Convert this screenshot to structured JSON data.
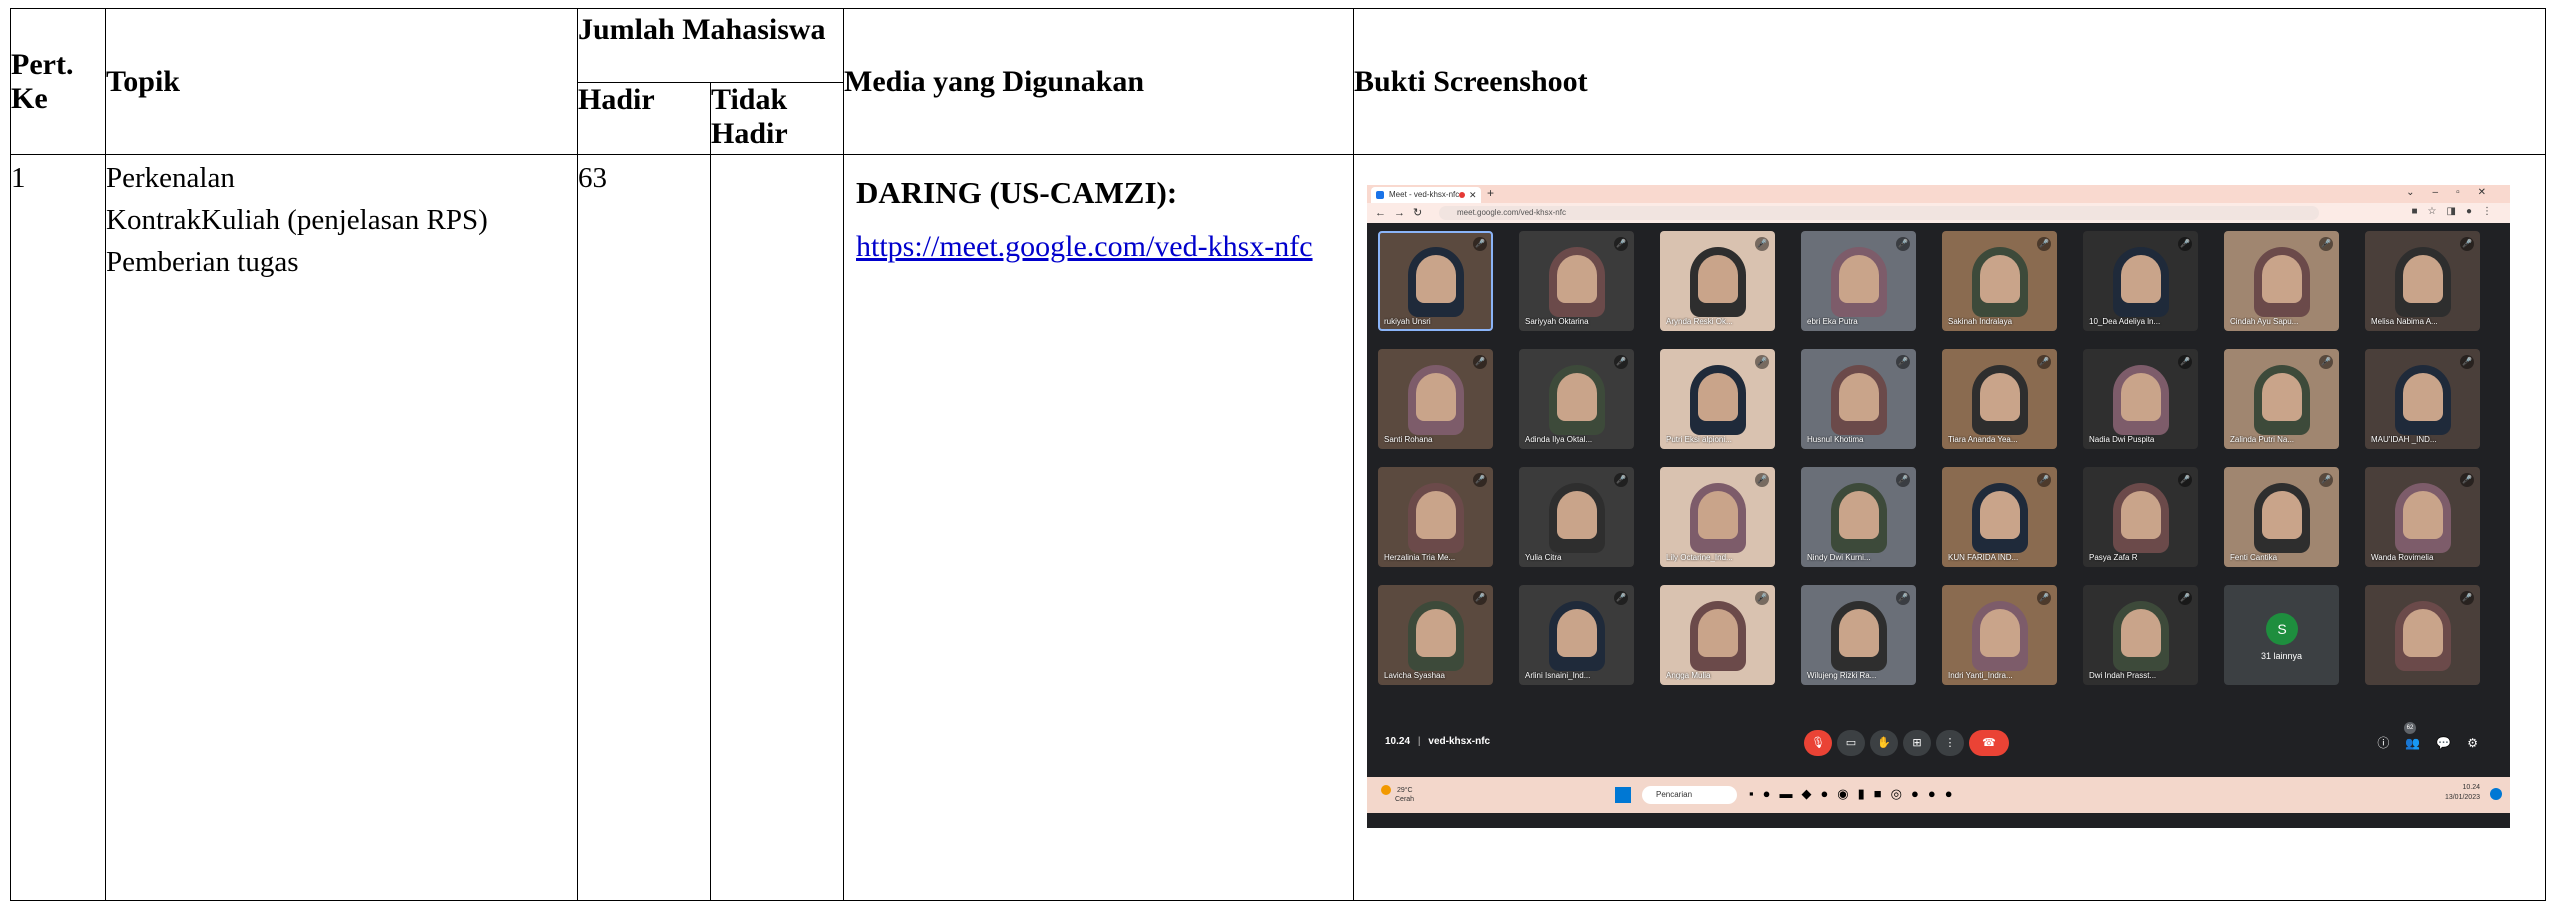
{
  "table": {
    "headers": {
      "pert_ke": "Pert. Ke",
      "topik": "Topik",
      "jumlah_mahasiswa": "Jumlah Mahasiswa",
      "hadir": "Hadir",
      "tidak_hadir": "Tidak Hadir",
      "media": "Media yang Digunakan",
      "bukti": "Bukti Screenshoot"
    },
    "row": {
      "pert_ke": "1",
      "topik_lines": [
        "Perkenalan",
        "KontrakKuliah (penjelasan RPS)",
        "Pemberian tugas"
      ],
      "hadir": "63",
      "tidak_hadir": "",
      "media_title": "DARING (US-CAMZI):",
      "media_link": "https://meet.google.com/ved-khsx-nfc"
    }
  },
  "screenshot": {
    "tab_title": "Meet - ved-khsx-nfc",
    "url": "meet.google.com/ved-khsx-nfc",
    "meeting_time": "10.24",
    "meeting_code": "ved-khsx-nfc",
    "participant_count_badge": "62",
    "participants": [
      "rukiyah Unsri",
      "Sariyyah Oktarina",
      "Arynda Reski Ok...",
      "ebri Eka Putra",
      "Sakinah Indralaya",
      "10_Dea Adeliya ln...",
      "Cindah Ayu Sapu...",
      "Melisa Nabima A...",
      "Santi Rohana",
      "Adinda Ilya Oktal...",
      "Putri Eksi alpioni...",
      "Husnul Khotima",
      "Tiara Ananda Yea...",
      "Nadia Dwi Puspita",
      "Zalinda Putri Na...",
      "MAU'IDAH _IND...",
      "Herzalinia Tria Me...",
      "Yulia Citra",
      "Lily Octarine_Ind...",
      "Nindy Dwi Kurni...",
      "KUN FARIDA IND...",
      "Pasya Zafa R",
      "Fenti Cantika",
      "Wanda Rovimelia",
      "Lavicha Syashaa",
      "Arlini Isnaini_Ind...",
      "Angga Mulia",
      "Wilujeng Rizki Ra...",
      "Indri Yanti_Indra...",
      "Dwi Indah Prasst...",
      "31 lainnya",
      ""
    ],
    "others_avatar_letter": "S",
    "taskbar": {
      "weather_temp": "29°C",
      "weather_desc": "Cerah",
      "search_placeholder": "Pencarian",
      "time": "10.24",
      "date": "13/01/2023"
    },
    "colors": {
      "meet_bg": "#202124",
      "tile_bg": "#3c4043",
      "end_call": "#ea4335",
      "link": "#0000cc"
    }
  }
}
